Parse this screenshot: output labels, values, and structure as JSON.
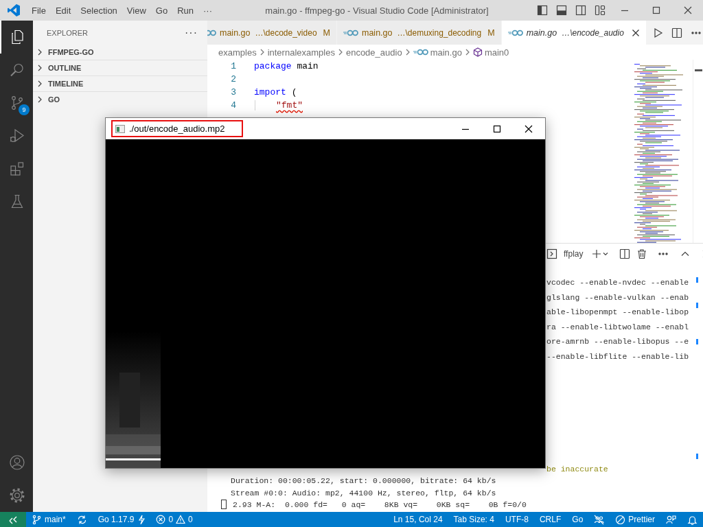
{
  "title_bar": {
    "menu": [
      "File",
      "Edit",
      "Selection",
      "View",
      "Go",
      "Run",
      "···"
    ],
    "title": "main.go - ffmpeg-go - Visual Studio Code [Administrator]"
  },
  "activity_bar": {
    "items": [
      {
        "kind": "files",
        "selected": true
      },
      {
        "kind": "search",
        "selected": false
      },
      {
        "kind": "source-control",
        "selected": false,
        "badge": "9"
      },
      {
        "kind": "run-debug",
        "selected": false
      },
      {
        "kind": "extensions",
        "selected": false
      },
      {
        "kind": "testing",
        "selected": false
      }
    ],
    "bottom": [
      {
        "kind": "account"
      },
      {
        "kind": "settings"
      }
    ]
  },
  "sidebar": {
    "title": "EXPLORER",
    "more": "···",
    "sections": [
      {
        "label": "FFMPEG-GO",
        "expanded": false
      },
      {
        "label": "OUTLINE",
        "expanded": false
      },
      {
        "label": "TIMELINE",
        "expanded": false
      },
      {
        "label": "GO",
        "expanded": false
      }
    ]
  },
  "tabs": [
    {
      "name": "main.go",
      "path": "…\\decode_video",
      "status": "M",
      "selected": false,
      "preview": false
    },
    {
      "name": "main.go",
      "path": "…\\demuxing_decoding",
      "status": "M",
      "selected": false,
      "preview": false
    },
    {
      "name": "main.go",
      "path": "…\\encode_audio",
      "selected": true,
      "preview": true
    }
  ],
  "breadcrumbs": [
    {
      "label": "examples",
      "kind": "folder"
    },
    {
      "label": "internalexamples",
      "kind": "folder"
    },
    {
      "label": "encode_audio",
      "kind": "folder"
    },
    {
      "label": "main.go",
      "kind": "go-file"
    },
    {
      "label": "main0",
      "kind": "symbol"
    }
  ],
  "code": [
    {
      "number": "1",
      "tokens": [
        {
          "text": "package",
          "kind": "keyword"
        },
        {
          "text": "main",
          "kind": "plain"
        }
      ]
    },
    {
      "number": "2"
    },
    {
      "number": "3",
      "tokens": [
        {
          "text": "import",
          "kind": "keyword"
        },
        {
          "text": "(",
          "kind": "plain"
        }
      ]
    },
    {
      "number": "4",
      "indented": true,
      "tokens": [
        {
          "text": "\"fmt\"",
          "kind": "string",
          "squiggle": true
        }
      ]
    }
  ],
  "panel": {
    "terminal": "ffplay",
    "lines": [
      {
        "text": "vcodec --enable-nvdec --enable",
        "kind": "clipped"
      },
      {
        "text": "glslang --enable-vulkan --enab",
        "kind": "clipped"
      },
      {
        "text": "able-libopenmpt --enable-libop",
        "kind": "clipped"
      },
      {
        "text": "ra --enable-libtwolame --enabl",
        "kind": "clipped"
      },
      {
        "text": "ore-amrnb --enable-libopus --e",
        "kind": "clipped"
      },
      {
        "text": "--enable-libflite --enable-lib",
        "kind": "clipped"
      },
      {
        "text": "be inaccurate",
        "kind": "warning-clipped"
      },
      {
        "text": "Duration: 00:00:05.22, start: 0.000000, bitrate: 64 kb/s",
        "kind": "indented"
      },
      {
        "text": "Stream #0:0: Audio: mp2, 44100 Hz, stereo, fltp, 64 kb/s",
        "kind": "indented"
      },
      {
        "text": "2.93 M-A:  0.000 fd=   0 aq=    8KB vq=    0KB sq=    0B f=0/0",
        "kind": "progress"
      }
    ]
  },
  "ffplay": {
    "title": "./out/encode_audio.mp2",
    "highlighted": true
  },
  "status_bar": {
    "left": [
      {
        "kind": "remote"
      },
      {
        "kind": "branch",
        "text": "main*"
      },
      {
        "kind": "sync"
      },
      {
        "kind": "go-version",
        "text": "Go 1.17.9"
      },
      {
        "kind": "problems",
        "errors": "0",
        "warnings": "0"
      }
    ],
    "right": [
      {
        "kind": "text",
        "text": "Ln 15, Col 24"
      },
      {
        "kind": "text",
        "text": "Tab Size: 4"
      },
      {
        "kind": "text",
        "text": "UTF-8"
      },
      {
        "kind": "text",
        "text": "CRLF"
      },
      {
        "kind": "text",
        "text": "Go"
      },
      {
        "kind": "crossed-people"
      },
      {
        "kind": "prettier",
        "text": "Prettier"
      },
      {
        "kind": "feedback"
      },
      {
        "kind": "bell"
      }
    ]
  }
}
